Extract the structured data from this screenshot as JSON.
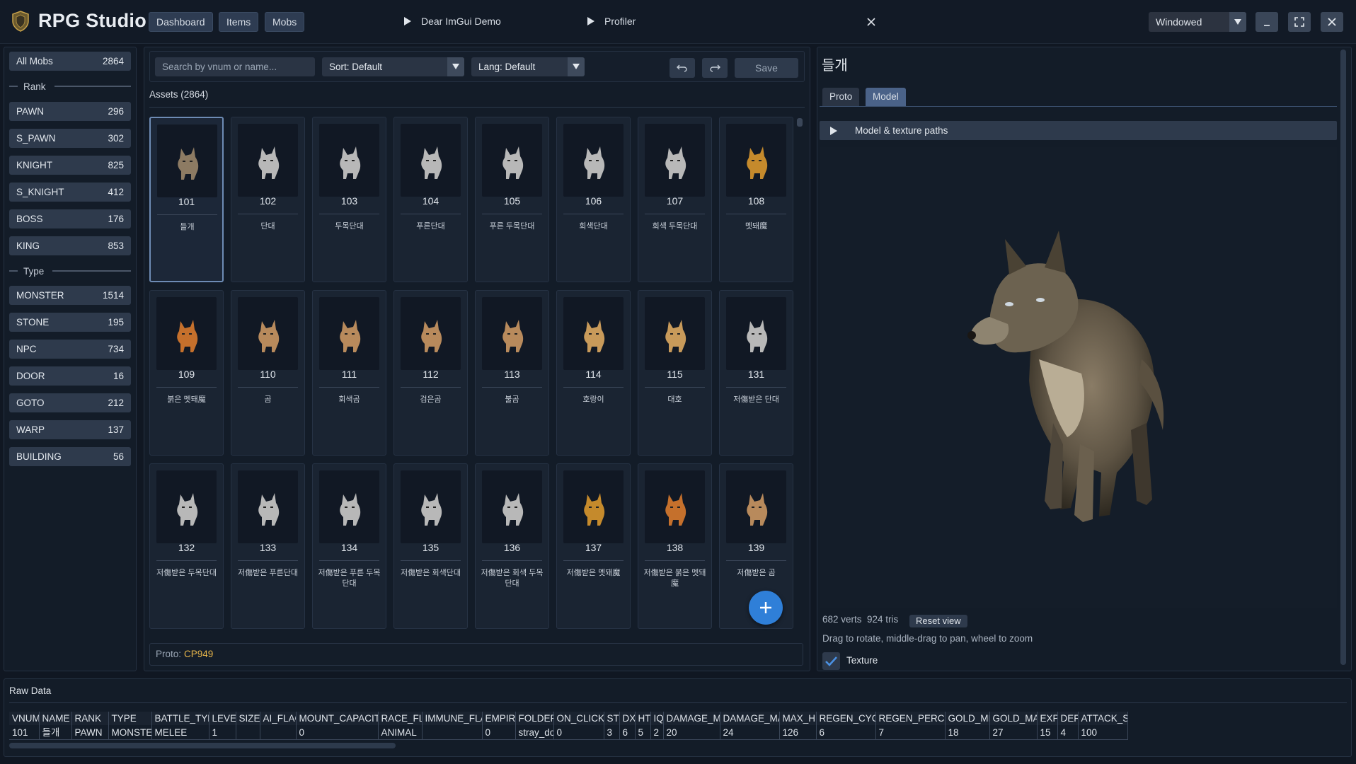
{
  "app": {
    "title": "RPG Studio"
  },
  "nav": {
    "dashboard": "Dashboard",
    "items": "Items",
    "mobs": "Mobs"
  },
  "titlebar": {
    "demo": "Dear ImGui Demo",
    "profiler": "Profiler",
    "window_mode": "Windowed"
  },
  "sidebar": {
    "all": {
      "label": "All Mobs",
      "count": "2864"
    },
    "rank_header": "Rank",
    "ranks": [
      {
        "label": "PAWN",
        "count": "296"
      },
      {
        "label": "S_PAWN",
        "count": "302"
      },
      {
        "label": "KNIGHT",
        "count": "825"
      },
      {
        "label": "S_KNIGHT",
        "count": "412"
      },
      {
        "label": "BOSS",
        "count": "176"
      },
      {
        "label": "KING",
        "count": "853"
      }
    ],
    "type_header": "Type",
    "types": [
      {
        "label": "MONSTER",
        "count": "1514"
      },
      {
        "label": "STONE",
        "count": "195"
      },
      {
        "label": "NPC",
        "count": "734"
      },
      {
        "label": "DOOR",
        "count": "16"
      },
      {
        "label": "GOTO",
        "count": "212"
      },
      {
        "label": "WARP",
        "count": "137"
      },
      {
        "label": "BUILDING",
        "count": "56"
      }
    ]
  },
  "toolbar": {
    "search_placeholder": "Search by vnum or name...",
    "sort": "Sort: Default",
    "lang": "Lang: Default",
    "save": "Save"
  },
  "assets": {
    "label": "Assets (2864)",
    "cards": [
      {
        "vnum": "101",
        "name": "들개",
        "color": "#8d7b63"
      },
      {
        "vnum": "102",
        "name": "단대",
        "color": "#b8b8b8"
      },
      {
        "vnum": "103",
        "name": "두목단대",
        "color": "#b8b8b8"
      },
      {
        "vnum": "104",
        "name": "푸른단대",
        "color": "#b8b8b8"
      },
      {
        "vnum": "105",
        "name": "푸른 두목단대",
        "color": "#b8b8b8"
      },
      {
        "vnum": "106",
        "name": "회색단대",
        "color": "#b8b8b8"
      },
      {
        "vnum": "107",
        "name": "회색 두목단대",
        "color": "#b8b8b8"
      },
      {
        "vnum": "108",
        "name": "멧돼魔",
        "color": "#c58a2c"
      },
      {
        "vnum": "109",
        "name": "붉은 멧돼魔",
        "color": "#c5702c"
      },
      {
        "vnum": "110",
        "name": "곰",
        "color": "#b88a5c"
      },
      {
        "vnum": "111",
        "name": "회색곰",
        "color": "#b88a5c"
      },
      {
        "vnum": "112",
        "name": "검은곰",
        "color": "#b88a5c"
      },
      {
        "vnum": "113",
        "name": "불곰",
        "color": "#b88a5c"
      },
      {
        "vnum": "114",
        "name": "호랑이",
        "color": "#c89a5a"
      },
      {
        "vnum": "115",
        "name": "대호",
        "color": "#c89a5a"
      },
      {
        "vnum": "131",
        "name": "저傷받은 단대",
        "color": "#b8b8b8"
      },
      {
        "vnum": "132",
        "name": "저傷받은 두목단대",
        "color": "#b8b8b8"
      },
      {
        "vnum": "133",
        "name": "저傷받은 푸른단대",
        "color": "#b8b8b8"
      },
      {
        "vnum": "134",
        "name": "저傷받은 푸른 두목단대",
        "color": "#b8b8b8"
      },
      {
        "vnum": "135",
        "name": "저傷받은 회색단대",
        "color": "#b8b8b8"
      },
      {
        "vnum": "136",
        "name": "저傷받은 회색 두목단대",
        "color": "#b8b8b8"
      },
      {
        "vnum": "137",
        "name": "저傷받은 멧돼魔",
        "color": "#c58a2c"
      },
      {
        "vnum": "138",
        "name": "저傷받은 붉은 멧돼魔",
        "color": "#c5702c"
      },
      {
        "vnum": "139",
        "name": "저傷받은 곰",
        "color": "#b88a5c"
      }
    ]
  },
  "proto_bar": {
    "label": "Proto:",
    "encoding": "CP949"
  },
  "detail": {
    "title": "들개",
    "tabs": [
      "Proto",
      "Model"
    ],
    "active_tab": "Model",
    "collapse_label": "Model & texture paths",
    "verts": "682 verts",
    "tris": "924 tris",
    "reset": "Reset view",
    "hint": "Drag to rotate, middle-drag to pan, wheel to zoom",
    "texture_label": "Texture",
    "texture_checked": true
  },
  "raw": {
    "label": "Raw Data",
    "headers": [
      "VNUM",
      "NAME",
      "RANK",
      "TYPE",
      "BATTLE_TYPE",
      "LEVEL",
      "SIZE",
      "AI_FLAG",
      "MOUNT_CAPACITY",
      "RACE_FLAG",
      "IMMUNE_FLAG",
      "EMPIRE",
      "FOLDER",
      "ON_CLICK",
      "ST",
      "DX",
      "HT",
      "IQ",
      "DAMAGE_MIN",
      "DAMAGE_MAX",
      "MAX_HP",
      "REGEN_CYCLE",
      "REGEN_PERCENT",
      "GOLD_MIN",
      "GOLD_MAX",
      "EXP",
      "DEF",
      "ATTACK_S"
    ],
    "row": [
      "101",
      "들개",
      "PAWN",
      "MONSTER",
      "MELEE",
      "1",
      "",
      "",
      "0",
      "ANIMAL",
      "",
      "0",
      "stray_dog",
      "0",
      "3",
      "6",
      "5",
      "2",
      "20",
      "24",
      "126",
      "6",
      "7",
      "18",
      "27",
      "15",
      "4",
      "100"
    ]
  }
}
